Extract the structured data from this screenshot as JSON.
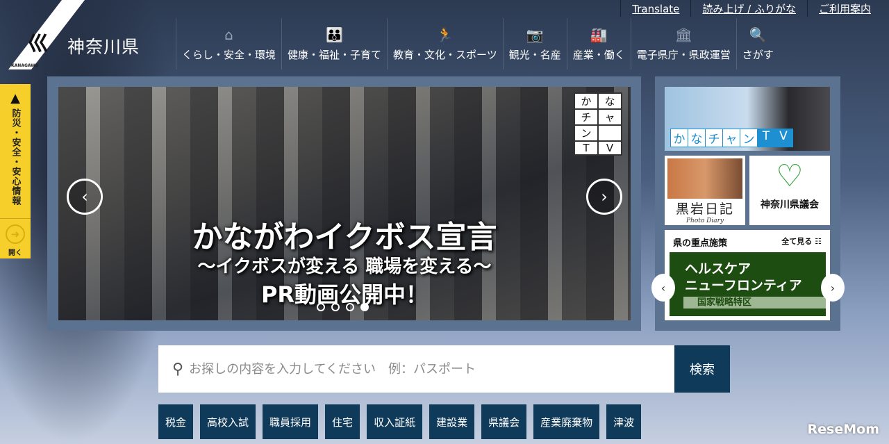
{
  "header": {
    "site_name": "神奈川県",
    "logo_text": "KANAGAWA",
    "top_links": [
      "Translate",
      "読み上げ / ふりがな",
      "ご利用案内"
    ],
    "nav": [
      {
        "label": "くらし・安全・環境",
        "icon": "house-icon",
        "glyph": "⌂"
      },
      {
        "label": "健康・福祉・子育て",
        "icon": "family-icon",
        "glyph": "👪"
      },
      {
        "label": "教育・文化・スポーツ",
        "icon": "runner-icon",
        "glyph": "🏃"
      },
      {
        "label": "観光・名産",
        "icon": "camera-icon",
        "glyph": "📷"
      },
      {
        "label": "産業・働く",
        "icon": "factory-icon",
        "glyph": "🏭"
      },
      {
        "label": "電子県庁・県政運営",
        "icon": "government-building-icon",
        "glyph": "🏛"
      },
      {
        "label": "さがす",
        "icon": "search-icon",
        "glyph": "🔍"
      }
    ]
  },
  "alert": {
    "label": "防災・安全・安心情報",
    "open": "開く"
  },
  "hero": {
    "title": "かながわイクボス宣言",
    "subtitle": "〜イクボスが変える 職場を変える〜",
    "cta": "PR動画公開中！",
    "badge": [
      "か",
      "な",
      "チ",
      "ャ",
      "ン",
      "T",
      "V"
    ],
    "active_slide": 4,
    "slide_count": 4
  },
  "side": {
    "tv": [
      "か",
      "な",
      "チ",
      "ャ",
      "ン",
      "T",
      "V"
    ],
    "diary_title": "黒岩日記",
    "diary_sub": "Photo Diary",
    "council": "神奈川県議会",
    "policy_heading": "県の重点施策",
    "policy_all": "全て見る ☷",
    "banner_line1": "ヘルスケア",
    "banner_line2": "ニューフロンティア",
    "banner_sub": "国家戦略特区"
  },
  "search": {
    "placeholder": "お探しの内容を入力してください　例：パスポート",
    "value": "",
    "button": "検索"
  },
  "tags": [
    "税金",
    "高校入試",
    "職員採用",
    "住宅",
    "収入証紙",
    "建設業",
    "県議会",
    "産業廃棄物",
    "津波"
  ],
  "watermark": "ReseMom"
}
